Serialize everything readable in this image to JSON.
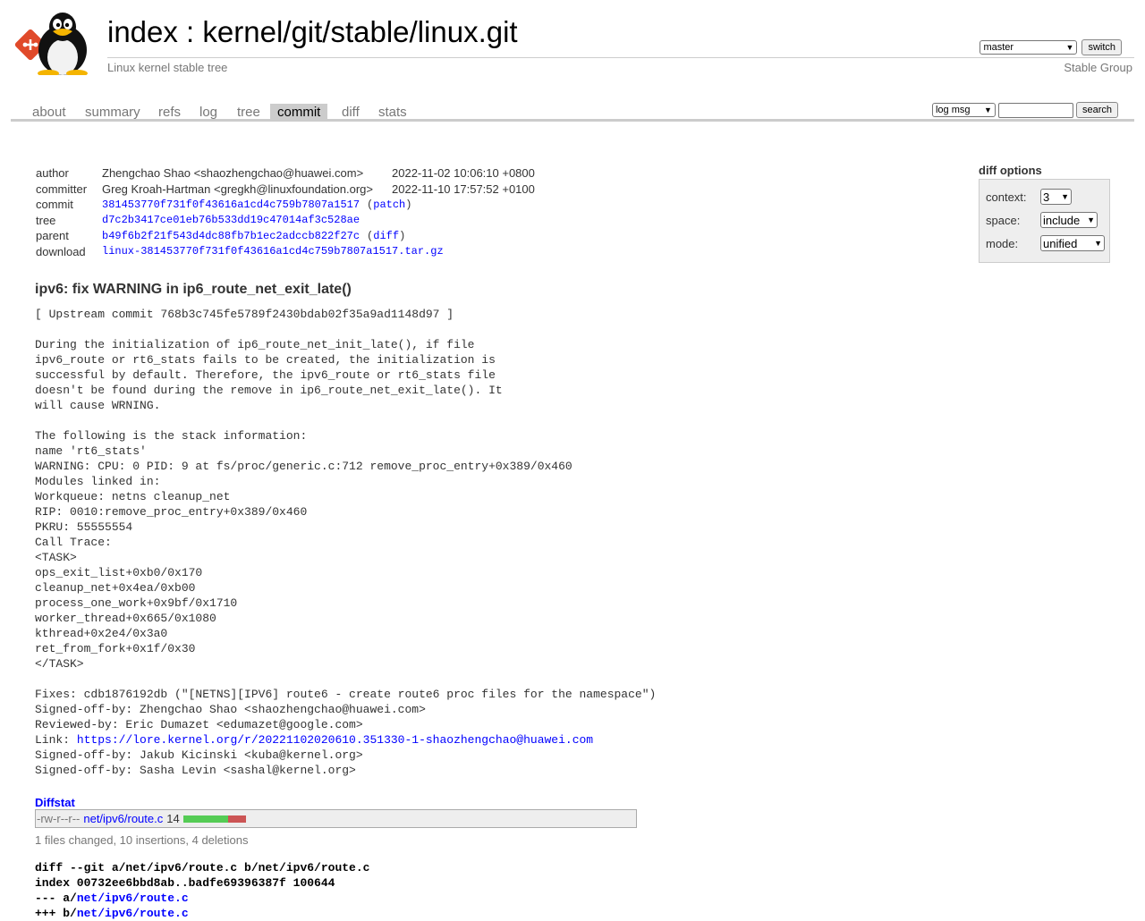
{
  "header": {
    "title": "index : kernel/git/stable/linux.git",
    "description": "Linux kernel stable tree",
    "owner": "Stable Group",
    "branch_selected": "master",
    "switch_label": "switch"
  },
  "tabs": [
    "about",
    "summary",
    "refs",
    "log",
    "tree",
    "commit",
    "diff",
    "stats"
  ],
  "active_tab": "commit",
  "search": {
    "mode": "log msg",
    "value": "",
    "button": "search"
  },
  "commit_info": {
    "author_label": "author",
    "author": "Zhengchao Shao <shaozhengchao@huawei.com>",
    "author_date": "2022-11-02 10:06:10 +0800",
    "committer_label": "committer",
    "committer": "Greg Kroah-Hartman <gregkh@linuxfoundation.org>",
    "committer_date": "2022-11-10 17:57:52 +0100",
    "commit_label": "commit",
    "commit": "381453770f731f0f43616a1cd4c759b7807a1517",
    "patch_link": "(patch)",
    "patch_open": "(",
    "patch_text": "patch",
    "patch_close": ")",
    "tree_label": "tree",
    "tree": "d7c2b3417ce01eb76b533dd19c47014af3c528ae",
    "parent_label": "parent",
    "parent": "b49f6b2f21f543d4dc88fb7b1ec2adccb822f27c",
    "diff_open": "(",
    "diff_text": "diff",
    "diff_close": ")",
    "download_label": "download",
    "download": "linux-381453770f731f0f43616a1cd4c759b7807a1517.tar.gz"
  },
  "diff_options": {
    "title": "diff options",
    "context_label": "context:",
    "context_value": "3",
    "space_label": "space:",
    "space_value": "include",
    "mode_label": "mode:",
    "mode_value": "unified"
  },
  "subject": "ipv6: fix WARNING in ip6_route_net_exit_late()",
  "message_before_link": "[ Upstream commit 768b3c745fe5789f2430bdab02f35a9ad1148d97 ]\n\nDuring the initialization of ip6_route_net_init_late(), if file\nipv6_route or rt6_stats fails to be created, the initialization is\nsuccessful by default. Therefore, the ipv6_route or rt6_stats file\ndoesn't be found during the remove in ip6_route_net_exit_late(). It\nwill cause WRNING.\n\nThe following is the stack information:\nname 'rt6_stats'\nWARNING: CPU: 0 PID: 9 at fs/proc/generic.c:712 remove_proc_entry+0x389/0x460\nModules linked in:\nWorkqueue: netns cleanup_net\nRIP: 0010:remove_proc_entry+0x389/0x460\nPKRU: 55555554\nCall Trace:\n<TASK>\nops_exit_list+0xb0/0x170\ncleanup_net+0x4ea/0xb00\nprocess_one_work+0x9bf/0x1710\nworker_thread+0x665/0x1080\nkthread+0x2e4/0x3a0\nret_from_fork+0x1f/0x30\n</TASK>\n\nFixes: cdb1876192db (\"[NETNS][IPV6] route6 - create route6 proc files for the namespace\")\nSigned-off-by: Zhengchao Shao <shaozhengchao@huawei.com>\nReviewed-by: Eric Dumazet <edumazet@google.com>\nLink: ",
  "message_link": "https://lore.kernel.org/r/20221102020610.351330-1-shaozhengchao@huawei.com",
  "message_after_link": "\nSigned-off-by: Jakub Kicinski <kuba@kernel.org>\nSigned-off-by: Sasha Levin <sashal@kernel.org>",
  "diffstat": {
    "title": "Diffstat",
    "mode": "-rw-r--r--",
    "file": "net/ipv6/route.c",
    "changes": "14",
    "insertions": 10,
    "deletions": 4,
    "summary": "1 files changed, 10 insertions, 4 deletions"
  },
  "diff_header": {
    "line1": "diff --git a/net/ipv6/route.c b/net/ipv6/route.c",
    "line2": "index 00732ee6bbd8ab..badfe69396387f 100644",
    "line3_prefix": "--- a/",
    "line3_path": "net/ipv6/route.c",
    "line4_prefix": "+++ b/",
    "line4_path": "net/ipv6/route.c"
  },
  "colors": {
    "link": "#0000ff",
    "insert": "#55cc55",
    "delete": "#cc5555",
    "tab_active": "#cccccc"
  }
}
